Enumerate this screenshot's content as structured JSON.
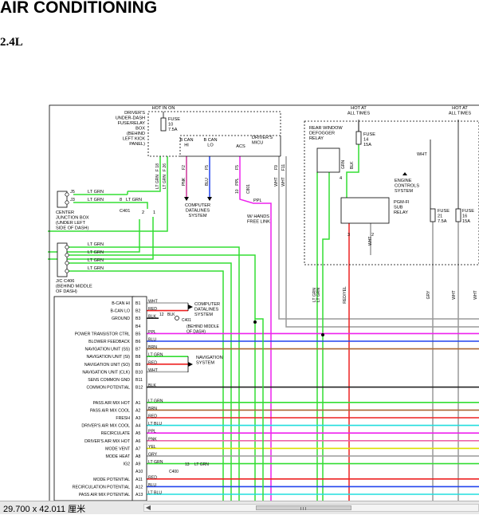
{
  "header": {
    "title": "AIR CONDITIONING",
    "subtitle": "2.4L"
  },
  "colors": {
    "wire_green": "#33dd33",
    "wire_red": "#ee2222",
    "wire_yellow": "#dddd00",
    "wire_magenta": "#ee22ee",
    "wire_blue": "#2244ee",
    "wire_cyan": "#22dddd",
    "wire_gray": "#9a9a9a",
    "wire_black": "#222222",
    "dashed_box": "#777777"
  },
  "top": {
    "hot_in_on": "HOT IN ON",
    "hot_at_all_times_1": "HOT AT ALL TIMES",
    "hot_at_all_times_2": "HOT AT ALL TIMES"
  },
  "drivers_box": {
    "label_lines": [
      "DRIVER'S",
      "UNDER-DASH",
      "FUSE/RELAY",
      "BOX",
      "(BEHIND",
      "LEFT KICK",
      "PANEL)"
    ]
  },
  "fuse10": {
    "label": "FUSE",
    "num": "10",
    "amp": "7.5A"
  },
  "micu": {
    "label_lines": [
      "DRIVER'S",
      "MICU"
    ],
    "bcan_hi": [
      "B CAN",
      "HI"
    ],
    "bcan_lo": [
      "B CAN",
      "LO"
    ],
    "acs": "ACS",
    "pins": [
      "F 18",
      "F 26",
      "F2",
      "F5",
      "F5",
      "F9",
      "F11"
    ],
    "wires": [
      "LT GRN",
      "LT GRN",
      "PNK",
      "BLU",
      "PPL",
      "WHT",
      "WHT"
    ]
  },
  "computer_datalines_top": [
    "COMPUTER",
    "DATALINES",
    "SYSTEM"
  ],
  "handsfree": {
    "pin": "10",
    "conn": "C801",
    "wire": "PPL",
    "label": [
      "W/ HANDS",
      "FREE LINK"
    ]
  },
  "center_jb": {
    "pins": [
      "J5",
      "J3"
    ],
    "wire1": "LT GRN",
    "wire2": "LT GRN",
    "conn": "C401",
    "pin2": "8",
    "label_lines": [
      "CENTER",
      "JUNCTION BOX",
      "(UNDER LEFT",
      "SIDE OF DASH)"
    ]
  },
  "splice_nums": [
    "2",
    "1"
  ],
  "jc": {
    "wires": [
      "LT GRN",
      "LT GRN",
      "LT GRN",
      "LT GRN"
    ],
    "label_lines": [
      "J/C C406",
      "(BEHIND MIDDLE",
      "OF DASH)"
    ]
  },
  "rear": {
    "label_lines": [
      "REAR WINDOW",
      "DEFOGGER",
      "RELAY"
    ],
    "fuse14": {
      "label": "FUSE",
      "num": "14",
      "amp": "15A"
    },
    "pins": [
      "4",
      "3"
    ],
    "wires": [
      "GRN",
      "BLK"
    ],
    "whtbar": "WHT"
  },
  "engine_ctrl": [
    "ENGINE",
    "CONTROLS",
    "SYSTEM"
  ],
  "pgm": {
    "label": [
      "PGM-FI",
      "SUB",
      "RELAY"
    ],
    "pins": [
      "3",
      "2"
    ],
    "wires": [
      "WHT",
      "WHT"
    ]
  },
  "fuse21": {
    "label": "FUSE",
    "num": "21",
    "amp": "7.5A"
  },
  "fuse16": {
    "label": "FUSE",
    "num": "16",
    "amp": "15A"
  },
  "vertical_wires": [
    "LT GRN",
    "LT GRN",
    "RED/YEL",
    "GRY",
    "WHT",
    "WHT"
  ],
  "computer_datalines_bottom": [
    "COMPUTER",
    "DATALINES",
    "SYSTEM"
  ],
  "c401b": {
    "pin": "12",
    "wire": "BLK",
    "conn": "C401",
    "sub": [
      "(BEHIND MIDDLE",
      "OF DASH)"
    ]
  },
  "nav_system": [
    "NAVIGATION",
    "SYSTEM"
  ],
  "c400": {
    "pin": "13",
    "wire": "LT GRN",
    "conn": "C400"
  },
  "connector_rows": [
    {
      "label": "B-CAN HI",
      "pin": "B1",
      "wire": "WHT"
    },
    {
      "label": "B-CAN LO",
      "pin": "B2",
      "wire": "RED"
    },
    {
      "label": "GROUND",
      "pin": "B3",
      "wire": "BLK"
    },
    {
      "label": "",
      "pin": "B4",
      "wire": ""
    },
    {
      "label": "POWER TRANSISTOR CTRL",
      "pin": "B5",
      "wire": "PPL"
    },
    {
      "label": "BLOWER FEEDBACK",
      "pin": "B6",
      "wire": "BLU"
    },
    {
      "label": "NAVIGATION UNIT (SS)",
      "pin": "B7",
      "wire": "BRN"
    },
    {
      "label": "NAVIGATION UNIT (SI)",
      "pin": "B8",
      "wire": "LT GRN"
    },
    {
      "label": "NAVIGATION UNIT (SO)",
      "pin": "B9",
      "wire": "RED"
    },
    {
      "label": "NAVIGATION UNIT (CLK)",
      "pin": "B10",
      "wire": "WHT"
    },
    {
      "label": "SENS COMMON GND",
      "pin": "B11",
      "wire": ""
    },
    {
      "label": "COMMON POTENTIAL",
      "pin": "B12",
      "wire": "BLK"
    },
    {
      "label": "",
      "pin": "",
      "wire": ""
    },
    {
      "label": "PASS AIR MIX HOT",
      "pin": "A1",
      "wire": "LT GRN"
    },
    {
      "label": "PASS AIR MIX COOL",
      "pin": "A2",
      "wire": "BRN"
    },
    {
      "label": "FRESH",
      "pin": "A3",
      "wire": "RED"
    },
    {
      "label": "DRIVER'S AIR MIX COOL",
      "pin": "A4",
      "wire": "LT BLU"
    },
    {
      "label": "RECIRCULATE",
      "pin": "A5",
      "wire": "PPL"
    },
    {
      "label": "DRIVER'S AIR MIX HOT",
      "pin": "A6",
      "wire": "PNK"
    },
    {
      "label": "MODE VENT",
      "pin": "A7",
      "wire": "YEL"
    },
    {
      "label": "MODE HEAT",
      "pin": "A8",
      "wire": "GRY"
    },
    {
      "label": "IG2",
      "pin": "A9",
      "wire": "LT GRN"
    },
    {
      "label": "",
      "pin": "A10",
      "wire": ""
    },
    {
      "label": "MODE POTENTIAL",
      "pin": "A11",
      "wire": "RED"
    },
    {
      "label": "RECIRCULATION POTENTIAL",
      "pin": "A12",
      "wire": "BLU"
    },
    {
      "label": "PASS AIR MIX POTENTIAL",
      "pin": "A13",
      "wire": "LT BLU"
    }
  ],
  "status": {
    "page_size": "29.700 x 42.011 厘米"
  }
}
